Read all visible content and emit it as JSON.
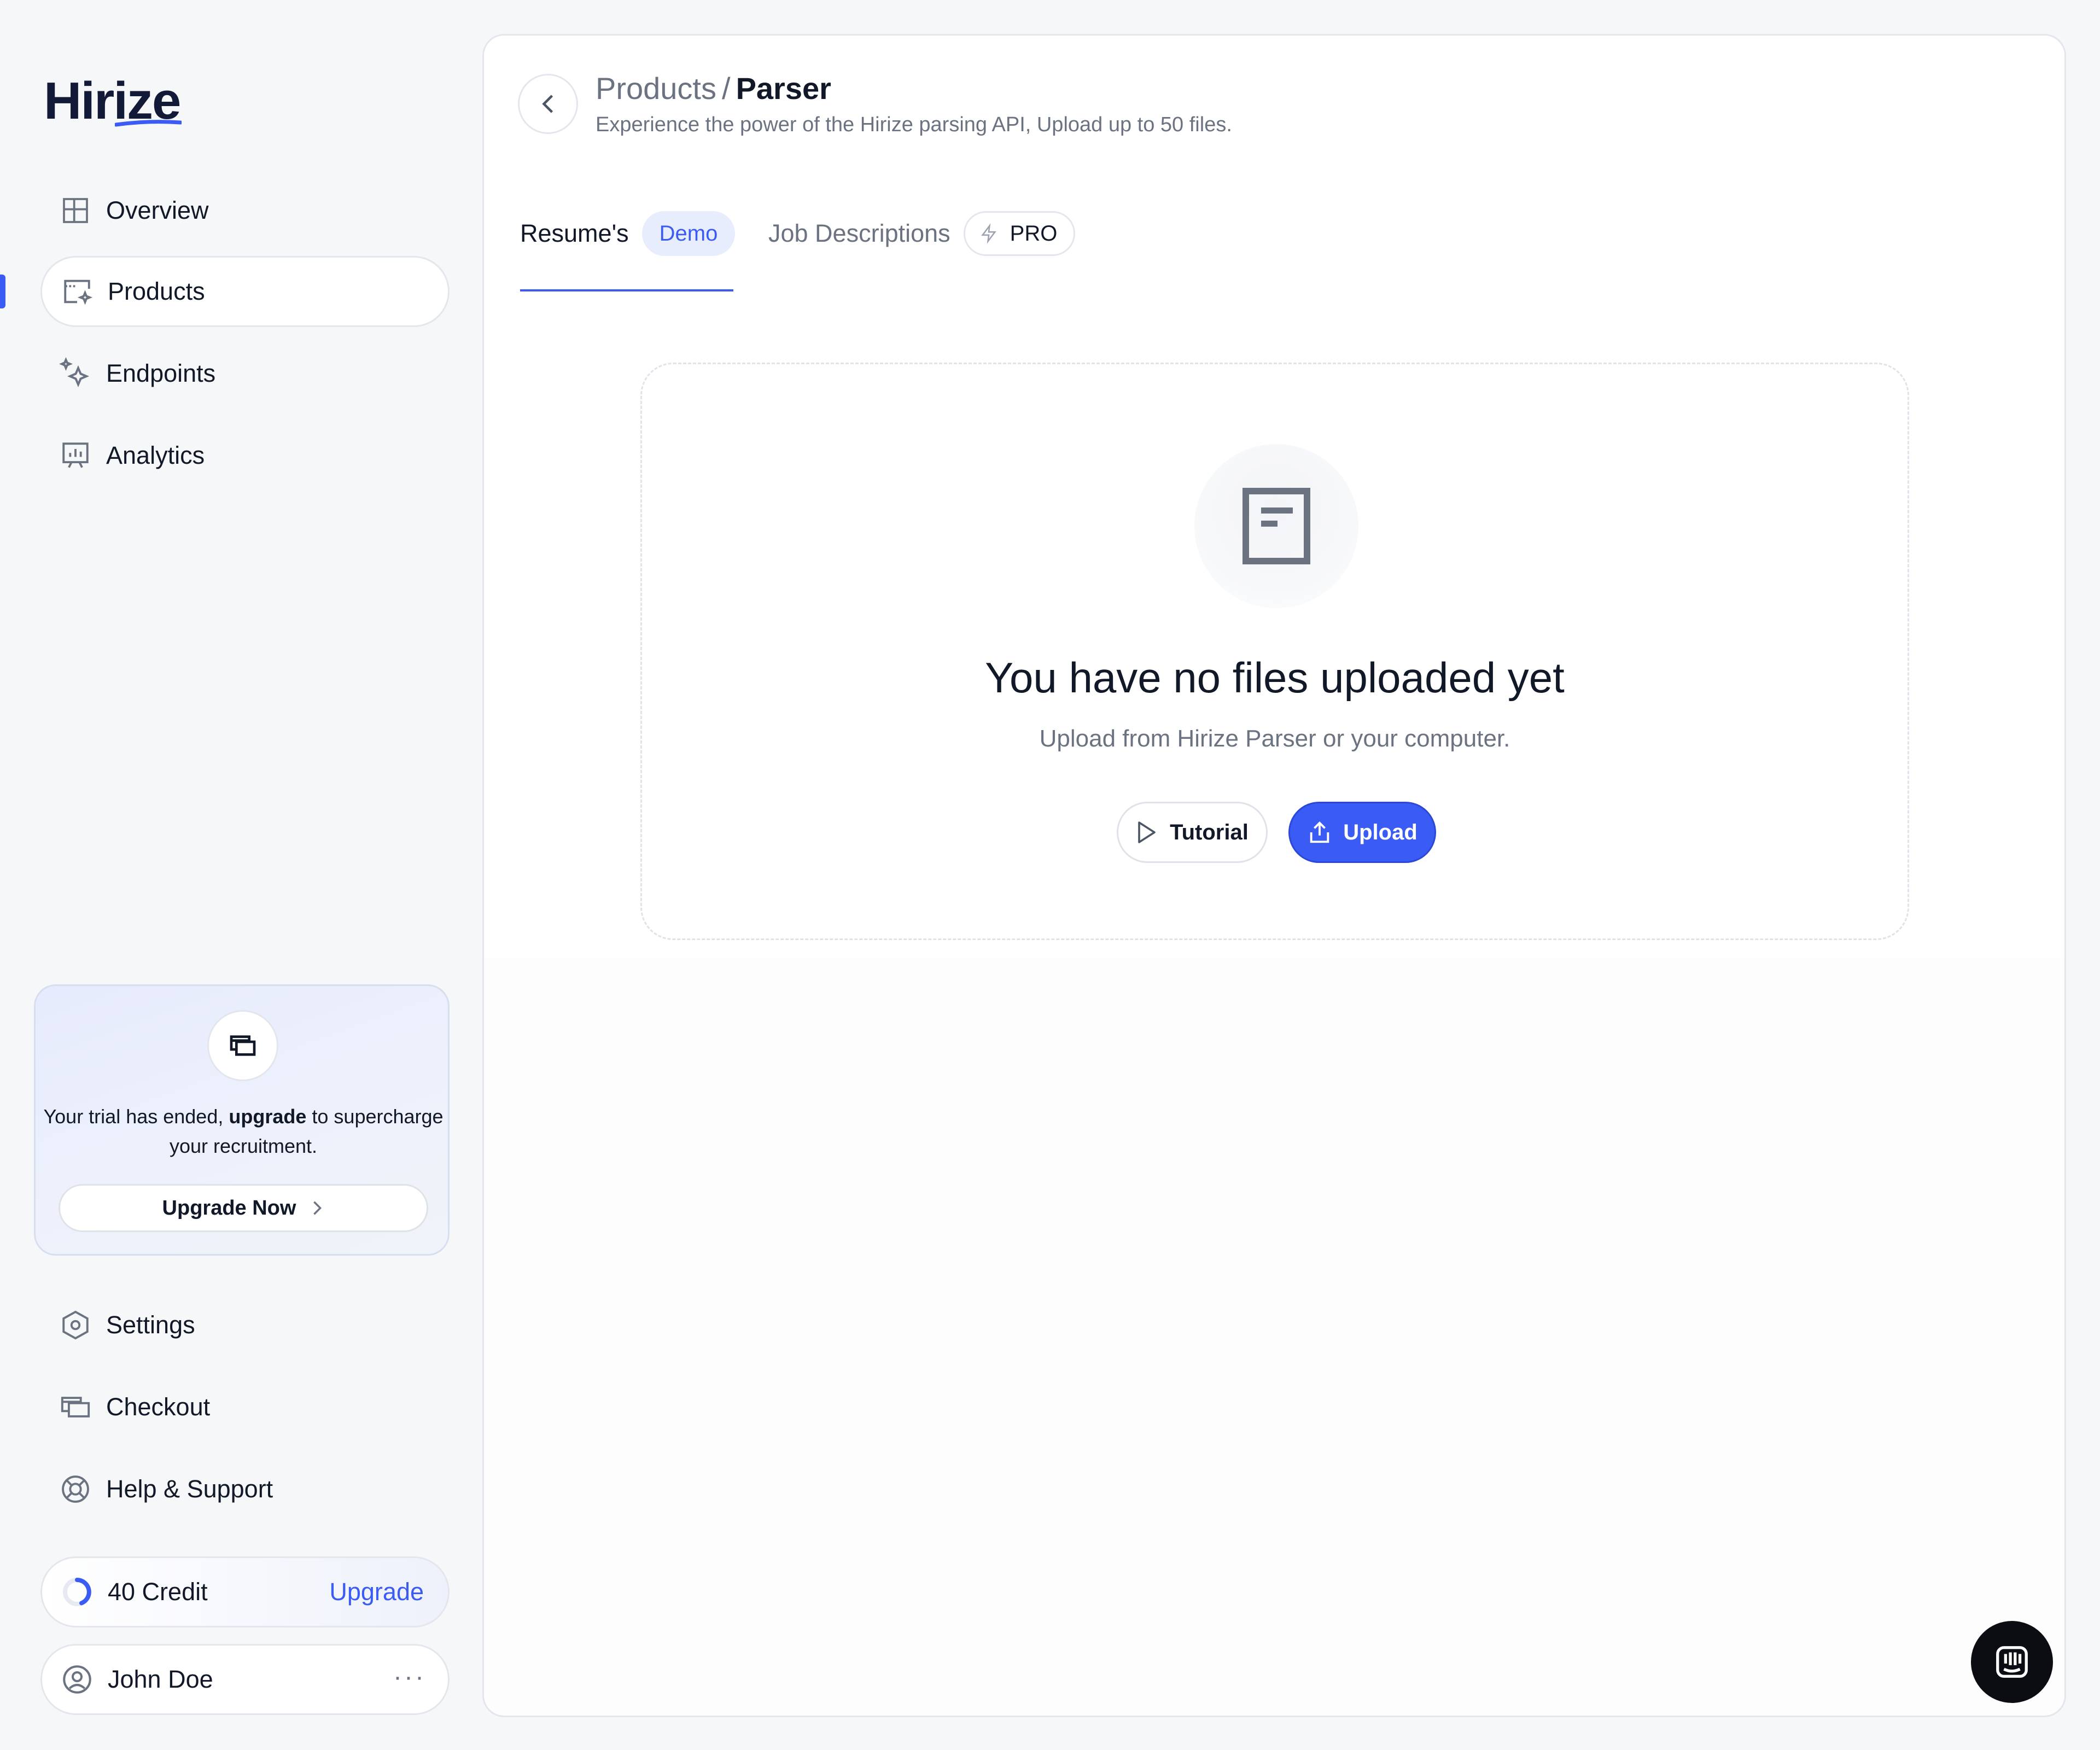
{
  "sidebar": {
    "logo": "Hirize",
    "nav": [
      {
        "label": "Overview",
        "icon": "grid-layout-icon"
      },
      {
        "label": "Products",
        "icon": "products-icon",
        "active": true
      },
      {
        "label": "Endpoints",
        "icon": "sparkle-icon"
      },
      {
        "label": "Analytics",
        "icon": "chart-board-icon"
      }
    ],
    "promo": {
      "icon": "wallet-icon",
      "text_prefix": "Your trial has ended,",
      "text_bold": "upgrade",
      "text_suffix": "to supercharge your recruitment.",
      "button_label": "Upgrade Now"
    },
    "bottom_nav": [
      {
        "label": "Settings",
        "icon": "hexagon-settings-icon"
      },
      {
        "label": "Checkout",
        "icon": "checkout-icon"
      },
      {
        "label": "Help & Support",
        "icon": "lifebuoy-icon"
      }
    ],
    "credit": {
      "label": "40 Credit",
      "link": "Upgrade"
    },
    "user": {
      "name": "John Doe",
      "menu": "···"
    }
  },
  "header": {
    "breadcrumb_parent": "Products",
    "breadcrumb_sep": "/",
    "breadcrumb_current": "Parser",
    "subtitle": "Experience the power of the Hirize parsing API, Upload up to 50 files."
  },
  "tabs": {
    "resume": {
      "label": "Resume's",
      "badge": "Demo"
    },
    "job": {
      "label": "Job Descriptions",
      "badge": "PRO"
    }
  },
  "empty_state": {
    "title": "You have no files uploaded yet",
    "subtitle": "Upload from Hirize Parser or your computer.",
    "tutorial_label": "Tutorial",
    "upload_label": "Upload"
  },
  "colors": {
    "accent": "#3b5bf5",
    "text": "#111827",
    "muted": "#6b7280"
  }
}
